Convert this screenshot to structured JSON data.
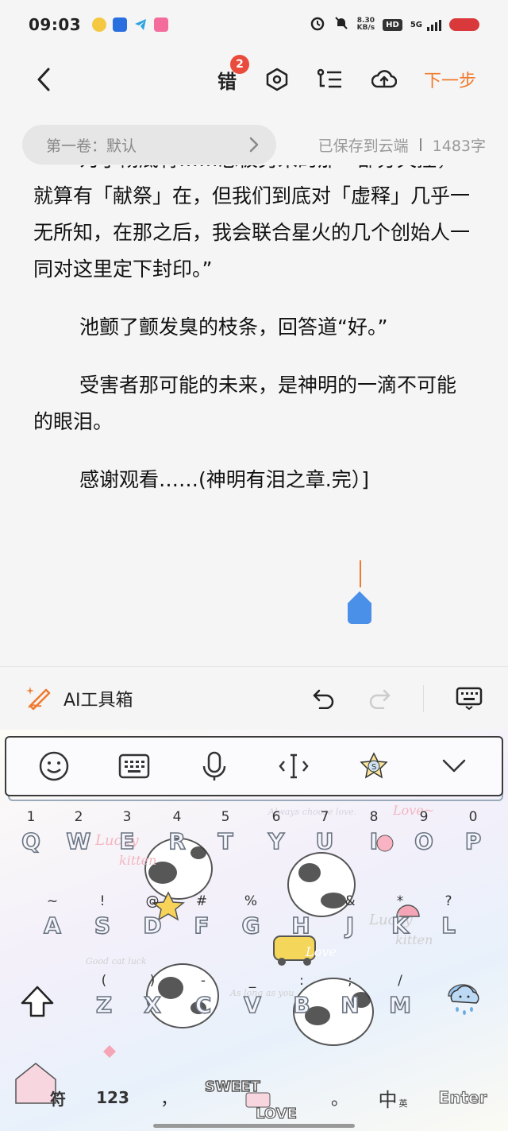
{
  "status_bar": {
    "time": "09:03",
    "net_speed_value": "8.30",
    "net_speed_unit": "KB/s",
    "hd": "HD",
    "net_type": "5G"
  },
  "toolbar": {
    "error_label": "错",
    "error_count": "2",
    "next_label": "下一步"
  },
  "info": {
    "volume": "第一卷：默认",
    "save_status": "已保存到云端",
    "word_count": "1483字"
  },
  "content": {
    "paragraphs": [
      "为了彻底将……总被另来的那一部分失控，就算有「献祭」在，但我们到底对「虚释」几乎一无所知，在那之后，我会联合星火的几个创始人一同对这里定下封印。”",
      "池颤了颤发臭的枝条，回答道“好。”",
      "受害者那可能的未来，是神明的一滴不可能的眼泪。",
      "感谢观看……(神明有泪之章.完）]"
    ]
  },
  "ai_toolbox": {
    "label": "AI工具箱"
  },
  "keyboard": {
    "row1": [
      {
        "hint": "1",
        "key": "Q"
      },
      {
        "hint": "2",
        "key": "W"
      },
      {
        "hint": "3",
        "key": "E"
      },
      {
        "hint": "4",
        "key": "R"
      },
      {
        "hint": "5",
        "key": "T"
      },
      {
        "hint": "6",
        "key": "Y"
      },
      {
        "hint": "7",
        "key": "U"
      },
      {
        "hint": "8",
        "key": "I"
      },
      {
        "hint": "9",
        "key": "O"
      },
      {
        "hint": "0",
        "key": "P"
      }
    ],
    "row2": [
      {
        "hint": "~",
        "key": "A"
      },
      {
        "hint": "!",
        "key": "S"
      },
      {
        "hint": "@",
        "key": "D"
      },
      {
        "hint": "#",
        "key": "F"
      },
      {
        "hint": "%",
        "key": "G"
      },
      {
        "hint": "",
        "key": "H"
      },
      {
        "hint": "&",
        "key": "J"
      },
      {
        "hint": "*",
        "key": "K"
      },
      {
        "hint": "?",
        "key": "L"
      }
    ],
    "row3": [
      {
        "hint": "(",
        "key": "Z"
      },
      {
        "hint": ")",
        "key": "X"
      },
      {
        "hint": "-",
        "key": "C"
      },
      {
        "hint": "_",
        "key": "V"
      },
      {
        "hint": ":",
        "key": "B"
      },
      {
        "hint": ";",
        "key": "N"
      },
      {
        "hint": "/",
        "key": "M"
      }
    ],
    "bottom": {
      "symbols": "符",
      "numbers": "123",
      "comma": "，",
      "period": "。",
      "lang": "中",
      "lang_sub": "英",
      "enter": "Enter"
    }
  },
  "colors": {
    "accent": "#f07a2e",
    "badge": "#e94b3c",
    "cursor_handle": "#4a8fe8"
  }
}
